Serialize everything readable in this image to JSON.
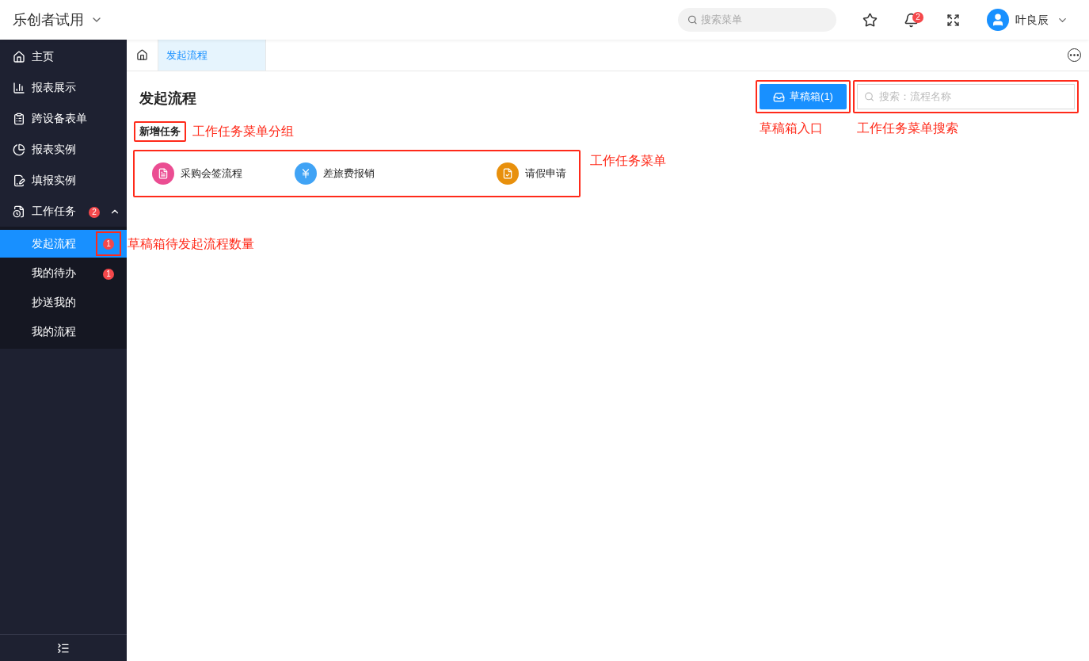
{
  "header": {
    "title": "乐创者试用",
    "search_placeholder": "搜索菜单",
    "notification_count": "2",
    "user": "叶良辰"
  },
  "sidebar": {
    "items": [
      {
        "label": "主页",
        "kind": "home"
      },
      {
        "label": "报表展示",
        "kind": "chart"
      },
      {
        "label": "跨设备表单",
        "kind": "form"
      },
      {
        "label": "报表实例",
        "kind": "pie"
      },
      {
        "label": "填报实例",
        "kind": "edit"
      },
      {
        "label": "工作任务",
        "kind": "task",
        "badge": "2",
        "expanded": true,
        "children": [
          {
            "label": "发起流程",
            "selected": true,
            "badge": "1",
            "note": "草稿箱待发起流程数量"
          },
          {
            "label": "我的待办",
            "selected": false,
            "badge": "1"
          },
          {
            "label": "抄送我的",
            "selected": false
          },
          {
            "label": "我的流程",
            "selected": false
          }
        ]
      }
    ]
  },
  "tabs": [
    {
      "label": "发起流程",
      "selected": true
    }
  ],
  "page": {
    "title": "发起流程",
    "drafts_button": "草稿箱(1)",
    "drafts_note": "草稿箱入口",
    "search_placeholder": "搜索：流程名称",
    "search_note": "工作任务菜单搜索",
    "group": "新增任务",
    "group_note": "工作任务菜单分组",
    "menu_note": "工作任务菜单",
    "tasks": [
      {
        "label": "采购会签流程",
        "kind": "purchase",
        "color": "#eb4d92"
      },
      {
        "label": "差旅费报销",
        "kind": "money",
        "color": "#40a3f5"
      },
      {
        "label": "请假申请",
        "kind": "leave",
        "color": "#e8900c"
      }
    ]
  }
}
